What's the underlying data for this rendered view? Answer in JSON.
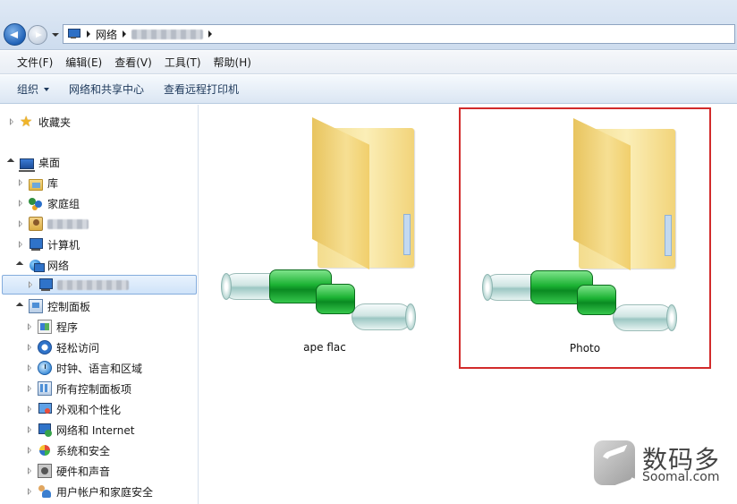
{
  "address_bar": {
    "crumbs": [
      "网络"
    ],
    "blurred_crumb": "(blurred computer name)"
  },
  "menu": {
    "items": [
      "文件(F)",
      "编辑(E)",
      "查看(V)",
      "工具(T)",
      "帮助(H)"
    ]
  },
  "commands": {
    "organize": "组织",
    "network_center": "网络和共享中心",
    "remote_printers": "查看远程打印机"
  },
  "nav_tree": {
    "favorites": "收藏夹",
    "desktop": "桌面",
    "libraries": "库",
    "homegroup": "家庭组",
    "computer": "计算机",
    "network": "网络",
    "control_panel": "控制面板",
    "cp_items": [
      "程序",
      "轻松访问",
      "时钟、语言和区域",
      "所有控制面板项",
      "外观和个性化",
      "网络和 Internet",
      "系统和安全",
      "硬件和声音",
      "用户帐户和家庭安全"
    ]
  },
  "content": {
    "items": [
      {
        "label": "ape flac",
        "icon": "shared-folder-icon"
      },
      {
        "label": "Photo",
        "icon": "shared-folder-icon",
        "highlighted": true
      }
    ]
  },
  "watermark": {
    "title": "数码多",
    "subtitle": "Soomal.com"
  },
  "colors": {
    "highlight_border": "#d22b2b",
    "selection_bg": "#cfe3f9"
  }
}
